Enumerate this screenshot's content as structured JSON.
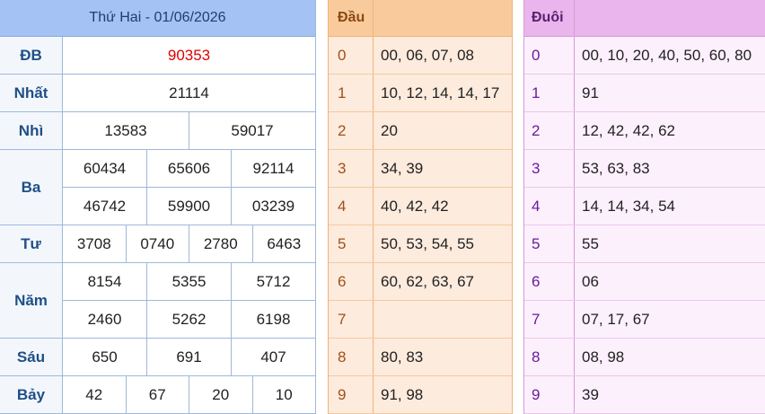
{
  "results": {
    "title": "Thứ Hai - 01/06/2026",
    "prizes": [
      {
        "label": "ĐB",
        "lines": [
          [
            "90353"
          ]
        ],
        "special": true
      },
      {
        "label": "Nhất",
        "lines": [
          [
            "21114"
          ]
        ]
      },
      {
        "label": "Nhì",
        "lines": [
          [
            "13583",
            "59017"
          ]
        ]
      },
      {
        "label": "Ba",
        "lines": [
          [
            "60434",
            "65606",
            "92114"
          ],
          [
            "46742",
            "59900",
            "03239"
          ]
        ]
      },
      {
        "label": "Tư",
        "lines": [
          [
            "3708",
            "0740",
            "2780",
            "6463"
          ]
        ]
      },
      {
        "label": "Năm",
        "lines": [
          [
            "8154",
            "5355",
            "5712"
          ],
          [
            "2460",
            "5262",
            "6198"
          ]
        ]
      },
      {
        "label": "Sáu",
        "lines": [
          [
            "650",
            "691",
            "407"
          ]
        ]
      },
      {
        "label": "Bảy",
        "lines": [
          [
            "42",
            "67",
            "20",
            "10"
          ]
        ]
      }
    ]
  },
  "dau": {
    "header": "Đầu",
    "rows": [
      {
        "key": "0",
        "value": "00, 06, 07, 08"
      },
      {
        "key": "1",
        "value": "10, 12, 14, 14, 17"
      },
      {
        "key": "2",
        "value": "20"
      },
      {
        "key": "3",
        "value": "34, 39"
      },
      {
        "key": "4",
        "value": "40, 42, 42"
      },
      {
        "key": "5",
        "value": "50, 53, 54, 55"
      },
      {
        "key": "6",
        "value": "60, 62, 63, 67"
      },
      {
        "key": "7",
        "value": ""
      },
      {
        "key": "8",
        "value": "80, 83"
      },
      {
        "key": "9",
        "value": "91, 98"
      }
    ]
  },
  "duoi": {
    "header": "Đuôi",
    "rows": [
      {
        "key": "0",
        "value": "00, 10, 20, 40, 50, 60, 80"
      },
      {
        "key": "1",
        "value": "91"
      },
      {
        "key": "2",
        "value": "12, 42, 42, 62"
      },
      {
        "key": "3",
        "value": "53, 63, 83"
      },
      {
        "key": "4",
        "value": "14, 14, 34, 54"
      },
      {
        "key": "5",
        "value": "55"
      },
      {
        "key": "6",
        "value": "06"
      },
      {
        "key": "7",
        "value": "07, 17, 67"
      },
      {
        "key": "8",
        "value": "08, 98"
      },
      {
        "key": "9",
        "value": "39"
      }
    ]
  },
  "colors": {
    "special_number": "#e00000",
    "results_header": "#a4c2f4",
    "dau_header": "#f9cb9c",
    "duoi_header": "#e9b5ec"
  }
}
